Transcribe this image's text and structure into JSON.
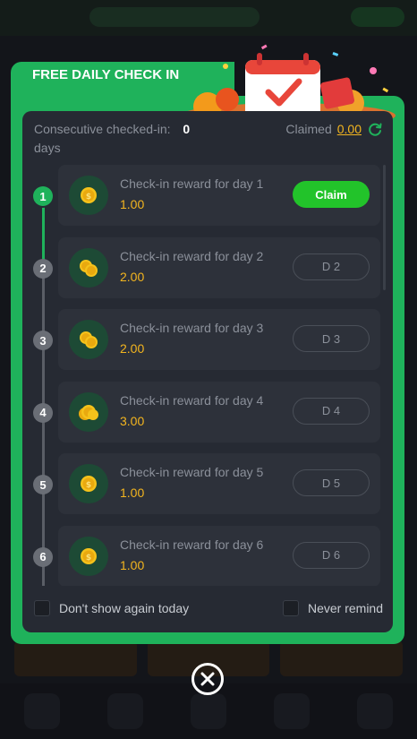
{
  "modal": {
    "title": "FREE DAILY CHECK IN",
    "streak_label": "Consecutive checked-in:",
    "streak_value": "0",
    "streak_unit": "days",
    "claimed_label": "Claimed",
    "claimed_value": "0.00",
    "rewards": [
      {
        "step": "1",
        "label": "Check-in reward for day 1",
        "amount": "1.00",
        "button": "Claim",
        "active": true,
        "coin": "single-coin-icon"
      },
      {
        "step": "2",
        "label": "Check-in reward for day 2",
        "amount": "2.00",
        "button": "D 2",
        "active": false,
        "coin": "two-coins-icon"
      },
      {
        "step": "3",
        "label": "Check-in reward for day 3",
        "amount": "2.00",
        "button": "D 3",
        "active": false,
        "coin": "two-coins-icon"
      },
      {
        "step": "4",
        "label": "Check-in reward for day 4",
        "amount": "3.00",
        "button": "D 4",
        "active": false,
        "coin": "coin-stack-icon"
      },
      {
        "step": "5",
        "label": "Check-in reward for day 5",
        "amount": "1.00",
        "button": "D 5",
        "active": false,
        "coin": "single-coin-icon"
      },
      {
        "step": "6",
        "label": "Check-in reward for day 6",
        "amount": "1.00",
        "button": "D 6",
        "active": false,
        "coin": "single-coin-icon"
      }
    ],
    "dont_show_today": "Don't show again today",
    "never_remind": "Never remind"
  },
  "colors": {
    "accent_green": "#1fb25b",
    "claim_green": "#22c32a",
    "gold": "#f3b51f",
    "panel": "#262a33",
    "card": "#2d313a"
  },
  "icons": {
    "refresh": "refresh-icon",
    "close": "close-icon",
    "banner": "calendar-gift-banner"
  }
}
